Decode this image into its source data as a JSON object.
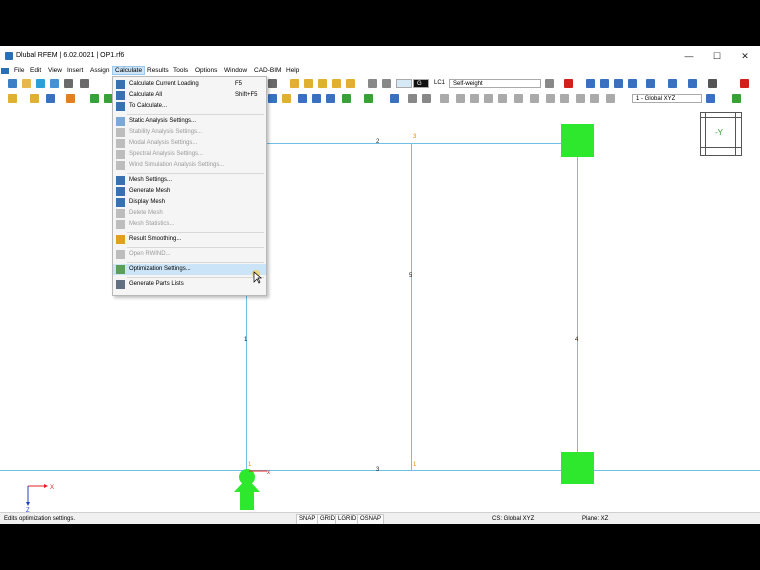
{
  "window": {
    "title": "Dlubal RFEM | 6.02.0021 | OP1.rf6",
    "minimize": "—",
    "maximize": "☐",
    "close": "✕"
  },
  "menubar": [
    "File",
    "Edit",
    "View",
    "Insert",
    "Assign",
    "Calculate",
    "Results",
    "Tools",
    "Options",
    "Window",
    "CAD-BIM",
    "Help"
  ],
  "toolbar": {
    "lc_tag": "G",
    "lc_name": "LC1",
    "lc_desc": "Self-weight",
    "cs_combo": "1 - Global XYZ"
  },
  "calculate_menu": [
    {
      "label": "Calculate Current Loading",
      "shortcut": "F5",
      "disabled": false,
      "icon_color": "#3a6fb0"
    },
    {
      "label": "Calculate All",
      "shortcut": "Shift+F5",
      "disabled": false,
      "icon_color": "#3a6fb0"
    },
    {
      "label": "To Calculate...",
      "shortcut": "",
      "disabled": false,
      "icon_color": "#3a6fb0"
    },
    {
      "sep": true
    },
    {
      "label": "Static Analysis Settings...",
      "shortcut": "",
      "disabled": false,
      "icon_color": "#7aa9d8"
    },
    {
      "label": "Stability Analysis Settings...",
      "shortcut": "",
      "disabled": true,
      "icon_color": "#bdbdbd"
    },
    {
      "label": "Modal Analysis Settings...",
      "shortcut": "",
      "disabled": true,
      "icon_color": "#bdbdbd"
    },
    {
      "label": "Spectral Analysis Settings...",
      "shortcut": "",
      "disabled": true,
      "icon_color": "#bdbdbd"
    },
    {
      "label": "Wind Simulation Analysis Settings...",
      "shortcut": "",
      "disabled": true,
      "icon_color": "#bdbdbd"
    },
    {
      "sep": true
    },
    {
      "label": "Mesh Settings...",
      "shortcut": "",
      "disabled": false,
      "icon_color": "#3a6fb0"
    },
    {
      "label": "Generate Mesh",
      "shortcut": "",
      "disabled": false,
      "icon_color": "#3a6fb0"
    },
    {
      "label": "Display Mesh",
      "shortcut": "",
      "disabled": false,
      "icon_color": "#3a6fb0"
    },
    {
      "label": "Delete Mesh",
      "shortcut": "",
      "disabled": true,
      "icon_color": "#bdbdbd"
    },
    {
      "label": "Mesh Statistics...",
      "shortcut": "",
      "disabled": true,
      "icon_color": "#bdbdbd"
    },
    {
      "sep": true
    },
    {
      "label": "Result Smoothing...",
      "shortcut": "",
      "disabled": false,
      "icon_color": "#e0a020"
    },
    {
      "sep": true
    },
    {
      "label": "Open RWIND...",
      "shortcut": "",
      "disabled": true,
      "icon_color": "#bdbdbd"
    },
    {
      "sep": true
    },
    {
      "label": "Optimization Settings...",
      "shortcut": "",
      "disabled": false,
      "highlighted": true,
      "icon_color": "#5aa05a"
    },
    {
      "sep": true
    },
    {
      "label": "Generate Parts Lists",
      "shortcut": "",
      "disabled": false,
      "icon_color": "#607080"
    }
  ],
  "model": {
    "line_labels": [
      "2",
      "5",
      "1",
      "4",
      "3"
    ],
    "node_labels": [
      "3",
      "1",
      "1"
    ],
    "axis_labels": {
      "x": "X",
      "z": "Z",
      "local_x": "x"
    },
    "viewcube_label": "-Y"
  },
  "statusbar": {
    "message": "Edits optimization settings.",
    "buttons": [
      "SNAP",
      "GRID",
      "LGRID",
      "OSNAP"
    ],
    "cs": "CS: Global XYZ",
    "plane": "Plane: XZ"
  },
  "colors": {
    "accent": "#cce4f7",
    "member": "#6ec1e4",
    "support": "#2ee82e"
  }
}
